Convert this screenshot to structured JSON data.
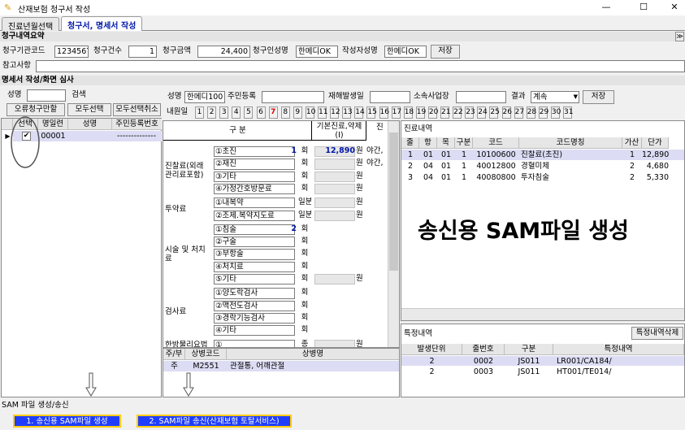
{
  "window": {
    "title": "산재보험 청구서 작성",
    "controls": {
      "minimize": "—",
      "maximize": "☐",
      "close": "✕"
    }
  },
  "tabs": [
    "진료년월선택",
    "청구서, 명세서 작성"
  ],
  "summary": {
    "section_title": "청구내역요약",
    "collapse_glyph": "≫",
    "fields": [
      {
        "label": "청구기관코드",
        "value": "1234567"
      },
      {
        "label": "청구건수",
        "value": "1"
      },
      {
        "label": "청구금액",
        "value": "24,400"
      },
      {
        "label": "청구인성명",
        "value": "한메디OK"
      },
      {
        "label": "작성자성명",
        "value": "한메디OK"
      }
    ],
    "save_label": "저장",
    "memo_label": "참고사항",
    "memo_value": ""
  },
  "detail_section_title": "명세서 작성/화면 심사",
  "left": {
    "name_label": "성명",
    "name_value": "",
    "search_label": "검색",
    "btn_error": "오류청구만할",
    "btn_select_all": "모두선택",
    "btn_deselect_all": "모두선택취소",
    "columns": [
      "선택",
      "명일련",
      "성명",
      "주민등록번호"
    ],
    "rows": [
      {
        "checked": "✔",
        "serial": "00001",
        "name": "",
        "rrn": "--------------"
      }
    ],
    "row_marker": "▶"
  },
  "patient": {
    "name_label": "성명",
    "name_value": "한메디100",
    "rrn_label": "주민등록",
    "rrn_value": "",
    "date_label": "재해발생일",
    "date_value": "",
    "workplace_label": "소속사업장",
    "workplace_value": "",
    "result_label": "결과",
    "result_value": "계속",
    "save_label": "저장",
    "visit_days_label": "내원일",
    "days": [
      "1",
      "2",
      "3",
      "4",
      "5",
      "6",
      "7",
      "8",
      "9",
      "10",
      "11",
      "12",
      "13",
      "14",
      "15",
      "16",
      "17",
      "18",
      "19",
      "20",
      "21",
      "22",
      "23",
      "24",
      "25",
      "26",
      "27",
      "28",
      "29",
      "30",
      "31"
    ]
  },
  "fees": {
    "header_category": "구 분",
    "header_base": "기본진료,약제 (I)",
    "header_next": "진",
    "groups": [
      {
        "name": "진찰료(외래관리료포함)",
        "items": [
          "①초진",
          "②재진",
          "③기타",
          "④가정간호방문료"
        ]
      },
      {
        "name": "투약료",
        "items": [
          "①내복약",
          "②조제.복약지도료"
        ]
      },
      {
        "name": "시술 및 처치료",
        "items": [
          "①침술",
          "②구술",
          "③부항술",
          "④처치료",
          "⑤기타"
        ]
      },
      {
        "name": "검사료",
        "items": [
          "①양도락검사",
          "②맥전도검사",
          "③경락기능검사",
          "④기타"
        ]
      },
      {
        "name": "한방물리요법",
        "items": [
          "①"
        ]
      }
    ],
    "unit_hoe": "회",
    "unit_won": "원",
    "unit_ilbun": "일분",
    "unit_jong": "종",
    "first_visit_count": "1",
    "first_visit_amount": "12,890",
    "acupuncture_count": "2",
    "night_label_1": "야간,",
    "night_label_2": "야간,"
  },
  "diagnosis": {
    "columns": [
      "주/부",
      "상병코드",
      "상병명"
    ],
    "rows": [
      {
        "type": "주",
        "code": "M2551",
        "name": "관절통, 어깨관절"
      }
    ]
  },
  "treatment": {
    "title": "진료내역",
    "columns": [
      "줄",
      "항",
      "목",
      "구분",
      "코드",
      "코드명칭",
      "가산",
      "단가"
    ],
    "rows": [
      {
        "line": "1",
        "hang": "01",
        "mok": "01",
        "gubun": "1",
        "code": "10100600",
        "name": "진찰료(초진)",
        "add": "1",
        "price": "12,890"
      },
      {
        "line": "2",
        "hang": "04",
        "mok": "01",
        "gubun": "1",
        "code": "40012800",
        "name": "경혈미체",
        "add": "2",
        "price": "4,680"
      },
      {
        "line": "3",
        "hang": "04",
        "mok": "01",
        "gubun": "1",
        "code": "40080800",
        "name": "투자침술",
        "add": "2",
        "price": "5,330"
      }
    ]
  },
  "overlay_text": "송신용 SAM파일 생성",
  "special": {
    "title": "특정내역",
    "delete_label": "특정내역삭제",
    "columns": [
      "발생단위",
      "줄번호",
      "구분",
      "특정내역"
    ],
    "rows": [
      {
        "unit": "2",
        "line": "0002",
        "gubun": "JS011",
        "detail": "LR001/CA184/"
      },
      {
        "unit": "2",
        "line": "0003",
        "gubun": "JS011",
        "detail": "HT001/TE014/"
      }
    ]
  },
  "footer": {
    "section_title": "SAM 파일 생성/송신",
    "btn_create": "1. 송신용 SAM파일 생성",
    "btn_send": "2. SAM파일 송신(산재보험 토탈서비스)"
  },
  "colors": {
    "accent_blue": "#1f3dff",
    "highlight_yellow": "#ffcc00",
    "tab_active": "#0018a8"
  }
}
